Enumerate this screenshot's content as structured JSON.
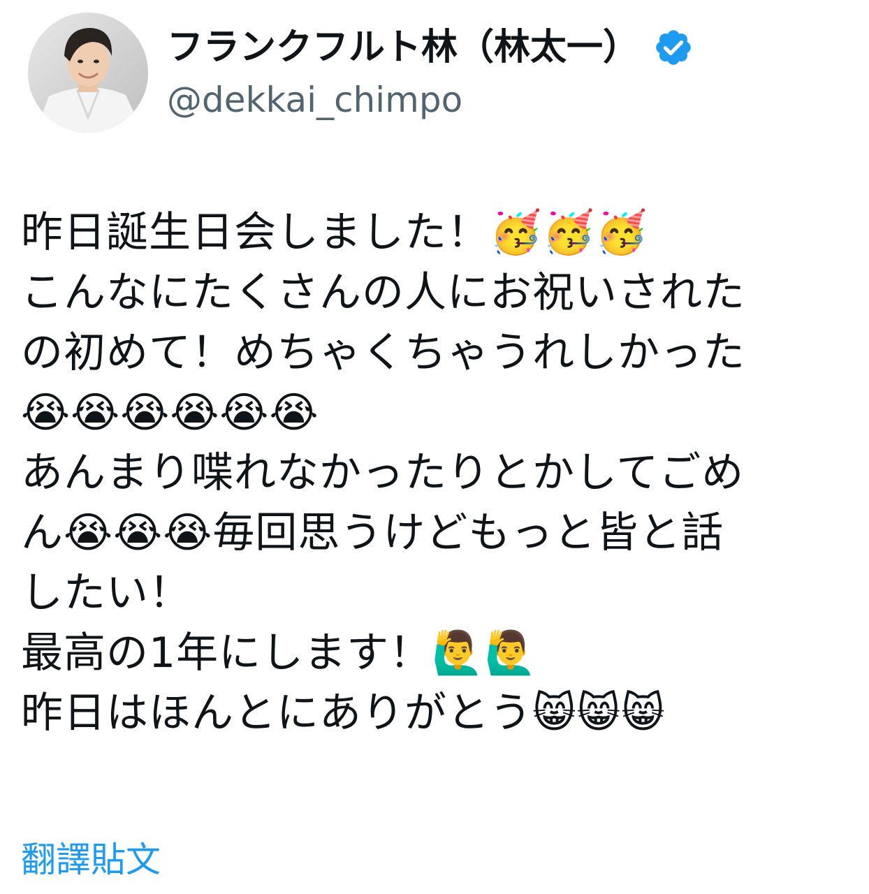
{
  "user": {
    "display_name": "フランクフルト林（林太一）",
    "handle": "@dekkai_chimpo",
    "verified_icon": "verified-badge-icon",
    "verified_color": "#1d9bf0",
    "avatar_icon": "user-avatar"
  },
  "tweet": {
    "lines": [
      "昨日誕生日会しました！🥳🥳🥳",
      "こんなにたくさんの人にお祝いされた",
      "の初めて！めちゃくちゃうれしかった",
      "😭😭😭😭😭😭",
      "あんまり喋れなかったりとかしてごめ",
      "ん😭😭😭毎回思うけどもっと皆と話",
      "したい！",
      "最高の1年にします！🙋‍♂️🙋‍♂️",
      "昨日はほんとにありがとう😸😸😸"
    ]
  },
  "actions": {
    "translate_label": "翻譯貼文",
    "link_color": "#1d9bf0"
  }
}
